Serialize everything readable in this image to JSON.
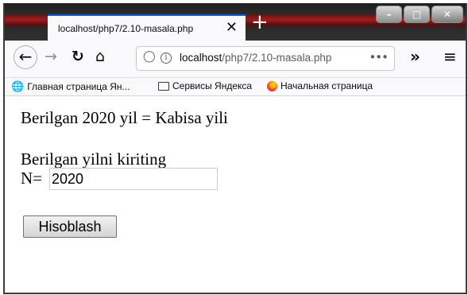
{
  "browser": {
    "tab_title": "localhost/php7/2.10-masala.php",
    "tab_close": "✕",
    "new_tab": "+",
    "window_controls": [
      "minimize",
      "maximize",
      "close"
    ],
    "url_host": "localhost",
    "url_path": "/php7/2.10-masala.php",
    "url_more": "•••",
    "bookmarks": [
      {
        "label": "Главная страница Ян...",
        "icon": "globe-icon"
      },
      {
        "label": "Сервисы Яндекса",
        "icon": "folder-icon"
      },
      {
        "label": "Начальная страница",
        "icon": "firefox-icon"
      }
    ]
  },
  "page": {
    "result_text": "Berilgan 2020 yil = Kabisa yili",
    "prompt_text": "Berilgan yilni kiriting",
    "n_label": "N=",
    "n_value": "2020",
    "submit_label": "Hisoblash"
  }
}
